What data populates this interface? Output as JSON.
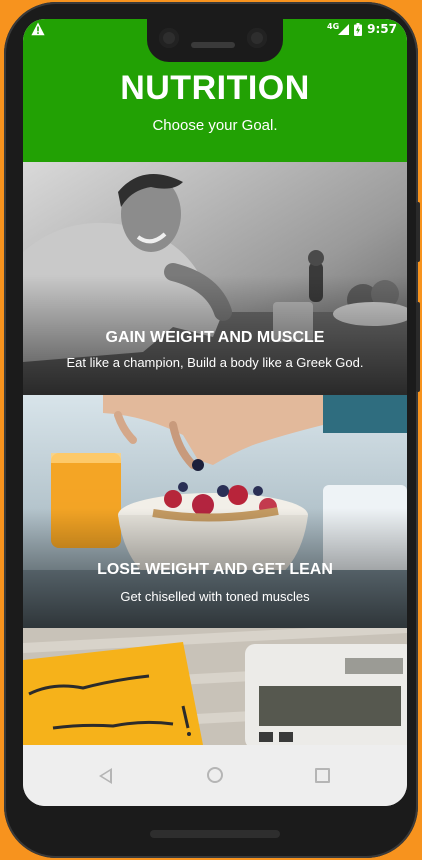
{
  "status_bar": {
    "network": "4G",
    "time": "9:57"
  },
  "header": {
    "title": "NUTRITION",
    "subtitle": "Choose your Goal."
  },
  "cards": [
    {
      "title": "GAIN WEIGHT AND MUSCLE",
      "subtitle": "Eat like a champion, Build a body like a Greek God."
    },
    {
      "title": "LOSE WEIGHT AND GET LEAN",
      "subtitle": "Get chiselled with toned muscles"
    },
    {
      "title": "",
      "subtitle": ""
    }
  ],
  "icons": [
    "warning-icon",
    "signal-icon",
    "battery-icon",
    "back-icon",
    "home-icon",
    "recents-icon"
  ],
  "colors": {
    "header_green": "#22a104",
    "device_background": "#f7931e",
    "nav_bar": "#eeeeee"
  }
}
